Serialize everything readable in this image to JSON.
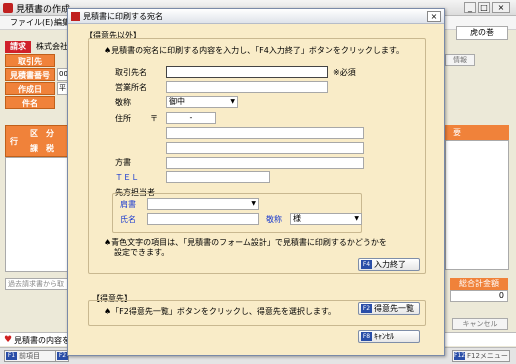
{
  "main": {
    "title": "見積書の作成",
    "menu": [
      "ファイル(E)",
      "編集(E)"
    ],
    "right_toolbar_label": "虎の巻",
    "invoice_tab": "請求",
    "company_text": "株式会社",
    "labels": {
      "customer": "取引先",
      "estimate_no": "見積書番号",
      "created_date": "作成日",
      "subject": "件名"
    },
    "estimate_no_value": "000",
    "created_date_value": "平",
    "grid": {
      "row_header": "行",
      "col1": "区　分",
      "col2": "課　税"
    },
    "right_col_header": "要",
    "info_button": "情報",
    "past_invoice_text": "過去請求書から取",
    "total_header": "総合計金額",
    "total_value": "0",
    "cancel_button": "キャンセル",
    "status_text": "見積書の内容を",
    "fkeys": [
      {
        "key": "F1",
        "label": "前項目"
      },
      {
        "key": "F2",
        "label": ""
      },
      {
        "key": "F12",
        "label": "F12メニュー"
      }
    ]
  },
  "dialog": {
    "title": "見積書に印刷する宛名",
    "close_icon": "×",
    "instruction_top": "♠見積書の宛名に印刷する内容を入力し、「F4入力終了」ボタンをクリックします。",
    "section_other": "【得意先以外】",
    "fields": {
      "customer_name_label": "取引先名",
      "customer_name_value": "",
      "required_note": "※必須",
      "branch_label": "営業所名",
      "branch_value": "",
      "honorific_label": "敬称",
      "honorific_value": "御中",
      "address_label": "住所",
      "postal_mark": "〒",
      "postal_value": "-",
      "address1": "",
      "address2": "",
      "address3": "",
      "attention_label": "方書",
      "attention_value": "",
      "tel_label": "ＴＥＬ",
      "tel_value": ""
    },
    "contact": {
      "group_label": "先方担当者",
      "title_label": "肩書",
      "title_value": "",
      "name_label": "氏名",
      "name_value": "",
      "honorific_label": "敬称",
      "honorific_value": "様"
    },
    "note_line1": "♠青色文字の項目は、「見積書のフォーム設計」で見積書に印刷するかどうかを",
    "note_line2": "設定できます。",
    "f4_button": {
      "key": "F4",
      "label": "入力終了"
    },
    "section_customer": "【得意先】",
    "customer_instruction": "♠「F2得意先一覧」ボタンをクリックし、得意先を選択します。",
    "f2_button": {
      "key": "F2",
      "label": "得意先一覧"
    },
    "f8_button": {
      "key": "F8",
      "label": "ｷｬﾝｾﾙ"
    }
  }
}
